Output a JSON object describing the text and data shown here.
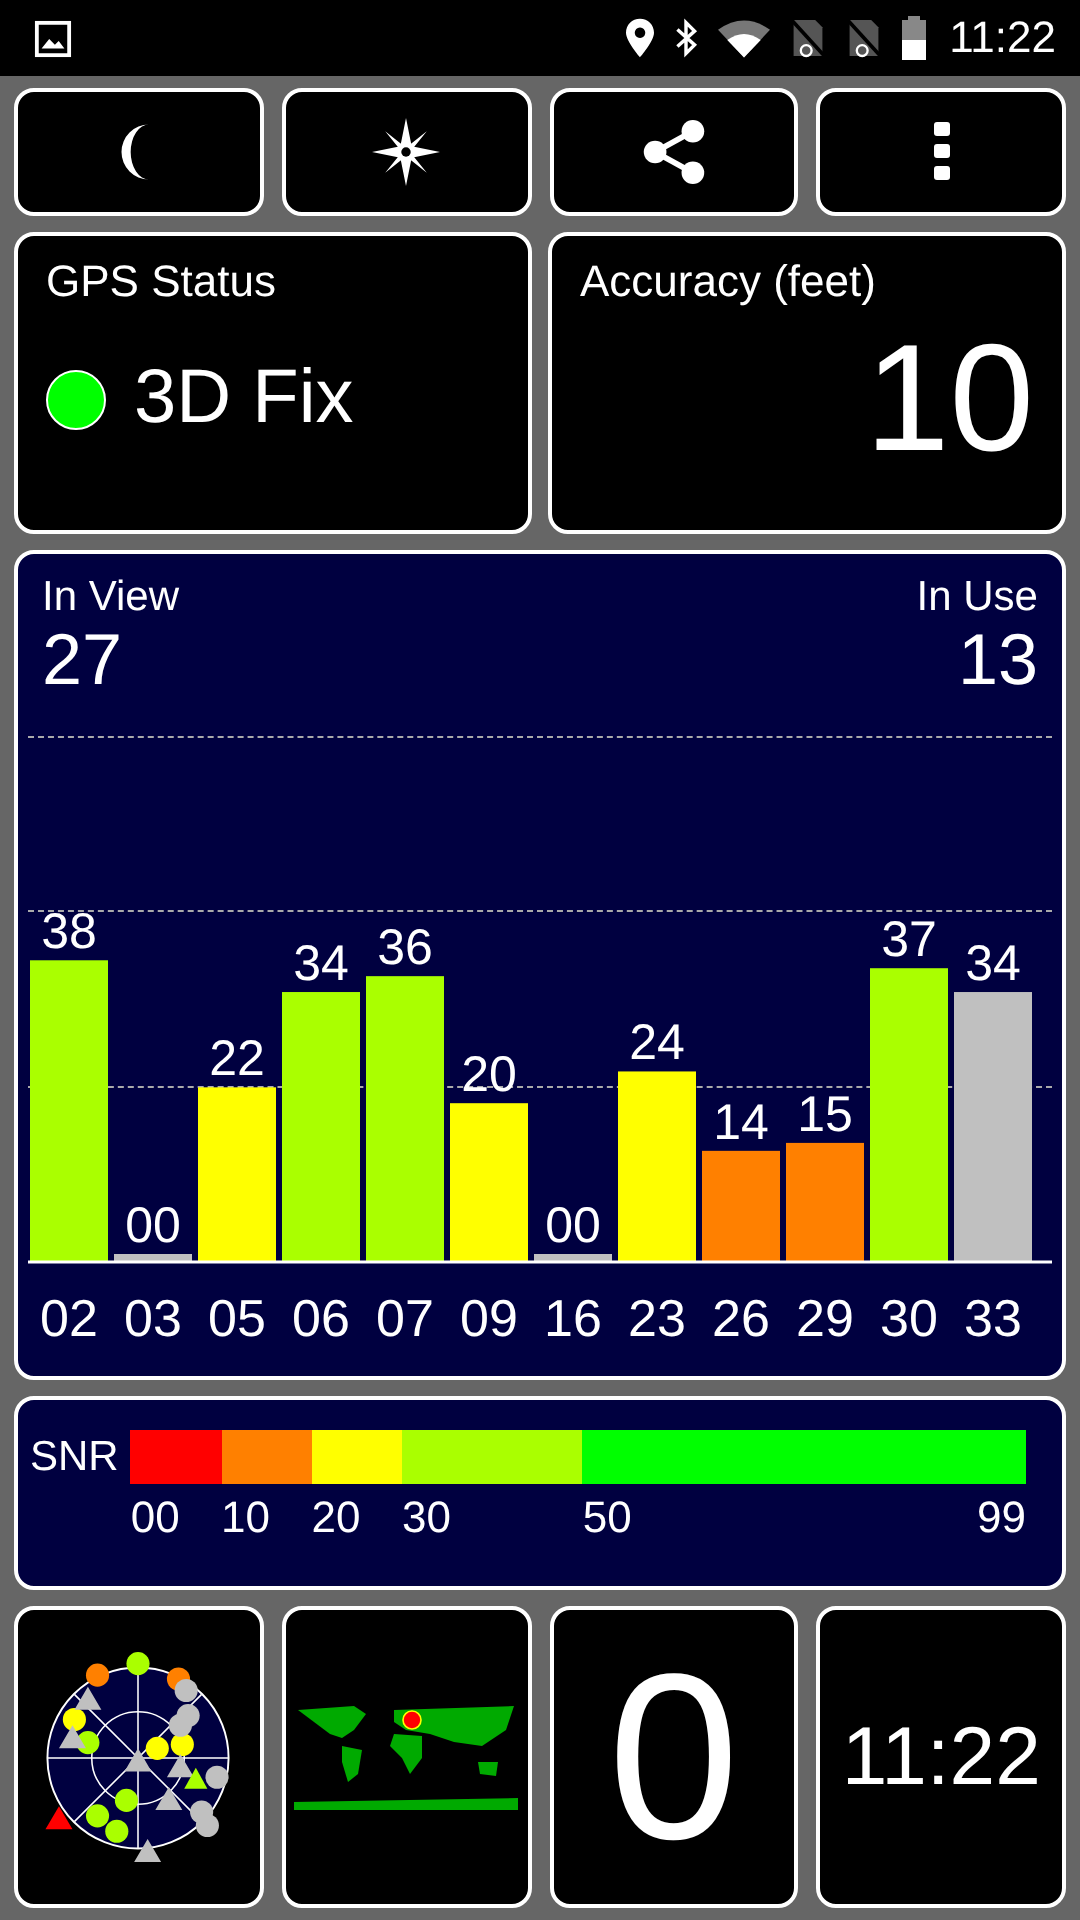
{
  "status_bar": {
    "time": "11:22"
  },
  "gps_status": {
    "title": "GPS Status",
    "fix_indicator": {
      "color": "#00ff00"
    },
    "fix": "3D Fix"
  },
  "accuracy": {
    "title": "Accuracy (feet)",
    "value": "10"
  },
  "satellites": {
    "in_view_label": "In View",
    "in_view": "27",
    "in_use_label": "In Use",
    "in_use": "13",
    "used": [
      true,
      false,
      true,
      true,
      true,
      true,
      false,
      true,
      true,
      true,
      true,
      false
    ],
    "chart_data": {
      "type": "bar",
      "categories": [
        "02",
        "03",
        "05",
        "06",
        "07",
        "09",
        "16",
        "23",
        "26",
        "29",
        "30",
        "33"
      ],
      "values": [
        38,
        0,
        22,
        34,
        36,
        20,
        0,
        24,
        14,
        15,
        37,
        34
      ],
      "value_labels": [
        "38",
        "00",
        "22",
        "34",
        "36",
        "20",
        "00",
        "24",
        "14",
        "15",
        "37",
        "34"
      ]
    }
  },
  "snr": {
    "label": "SNR",
    "segments": [
      {
        "color": "#ff0000",
        "tick": "00"
      },
      {
        "color": "#ff8000",
        "tick": "10"
      },
      {
        "color": "#ffff00",
        "tick": "20"
      },
      {
        "color": "#aaff00",
        "tick": "30"
      },
      {
        "color": "#00ff00",
        "tick": "50"
      }
    ],
    "end_tick": "99"
  },
  "tiles": {
    "satellite_count": "0",
    "clock": "11:22"
  }
}
